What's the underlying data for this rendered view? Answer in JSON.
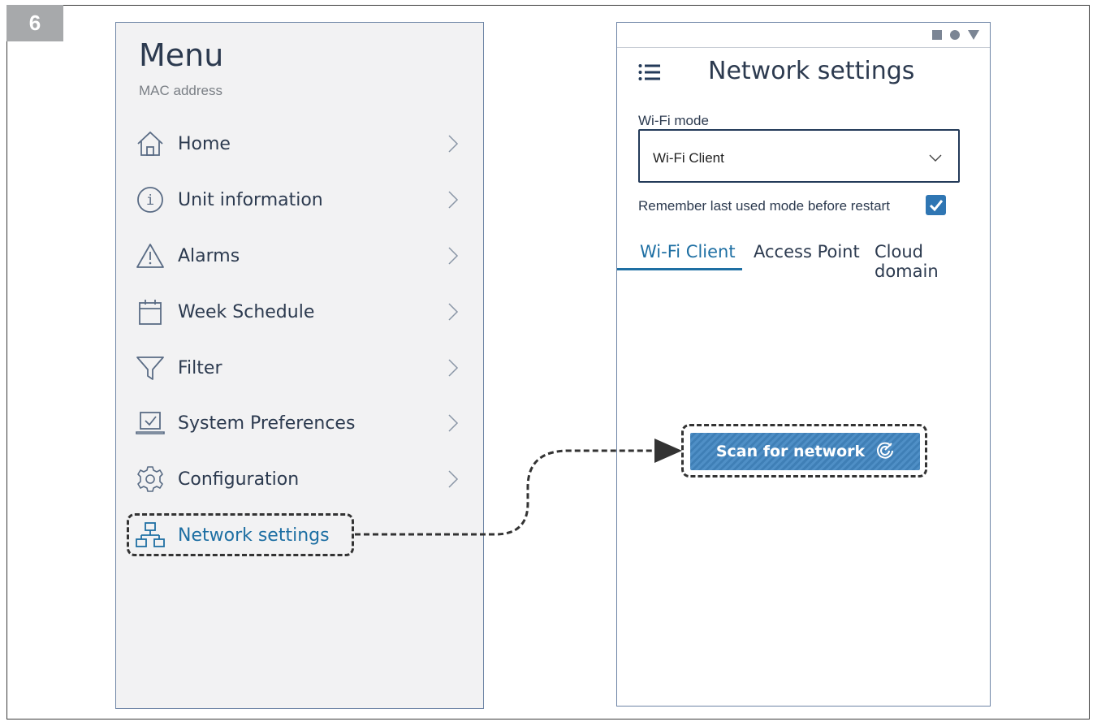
{
  "step_number": "6",
  "menu": {
    "title": "Menu",
    "subtitle": "MAC address",
    "items": [
      {
        "label": "Home",
        "icon": "home-icon"
      },
      {
        "label": "Unit information",
        "icon": "info-icon"
      },
      {
        "label": "Alarms",
        "icon": "alert-triangle-icon"
      },
      {
        "label": "Week Schedule",
        "icon": "calendar-icon"
      },
      {
        "label": "Filter",
        "icon": "filter-icon"
      },
      {
        "label": "System Preferences",
        "icon": "laptop-check-icon"
      },
      {
        "label": "Configuration",
        "icon": "gear-icon"
      },
      {
        "label": "Network settings",
        "icon": "network-icon"
      }
    ]
  },
  "network": {
    "title": "Network settings",
    "wifi_mode_label": "Wi-Fi mode",
    "wifi_mode_value": "Wi-Fi Client",
    "remember_label": "Remember last used mode before restart",
    "remember_checked": true,
    "tabs": [
      {
        "label": "Wi-Fi Client",
        "active": true
      },
      {
        "label": "Access Point",
        "active": false
      },
      {
        "label": "Cloud domain",
        "active": false
      }
    ],
    "scan_button": "Scan for network"
  },
  "colors": {
    "accent": "#1e6fa3",
    "text": "#2c3a4f",
    "panel_bg": "#f2f2f3",
    "button": "#4f8fc6"
  }
}
